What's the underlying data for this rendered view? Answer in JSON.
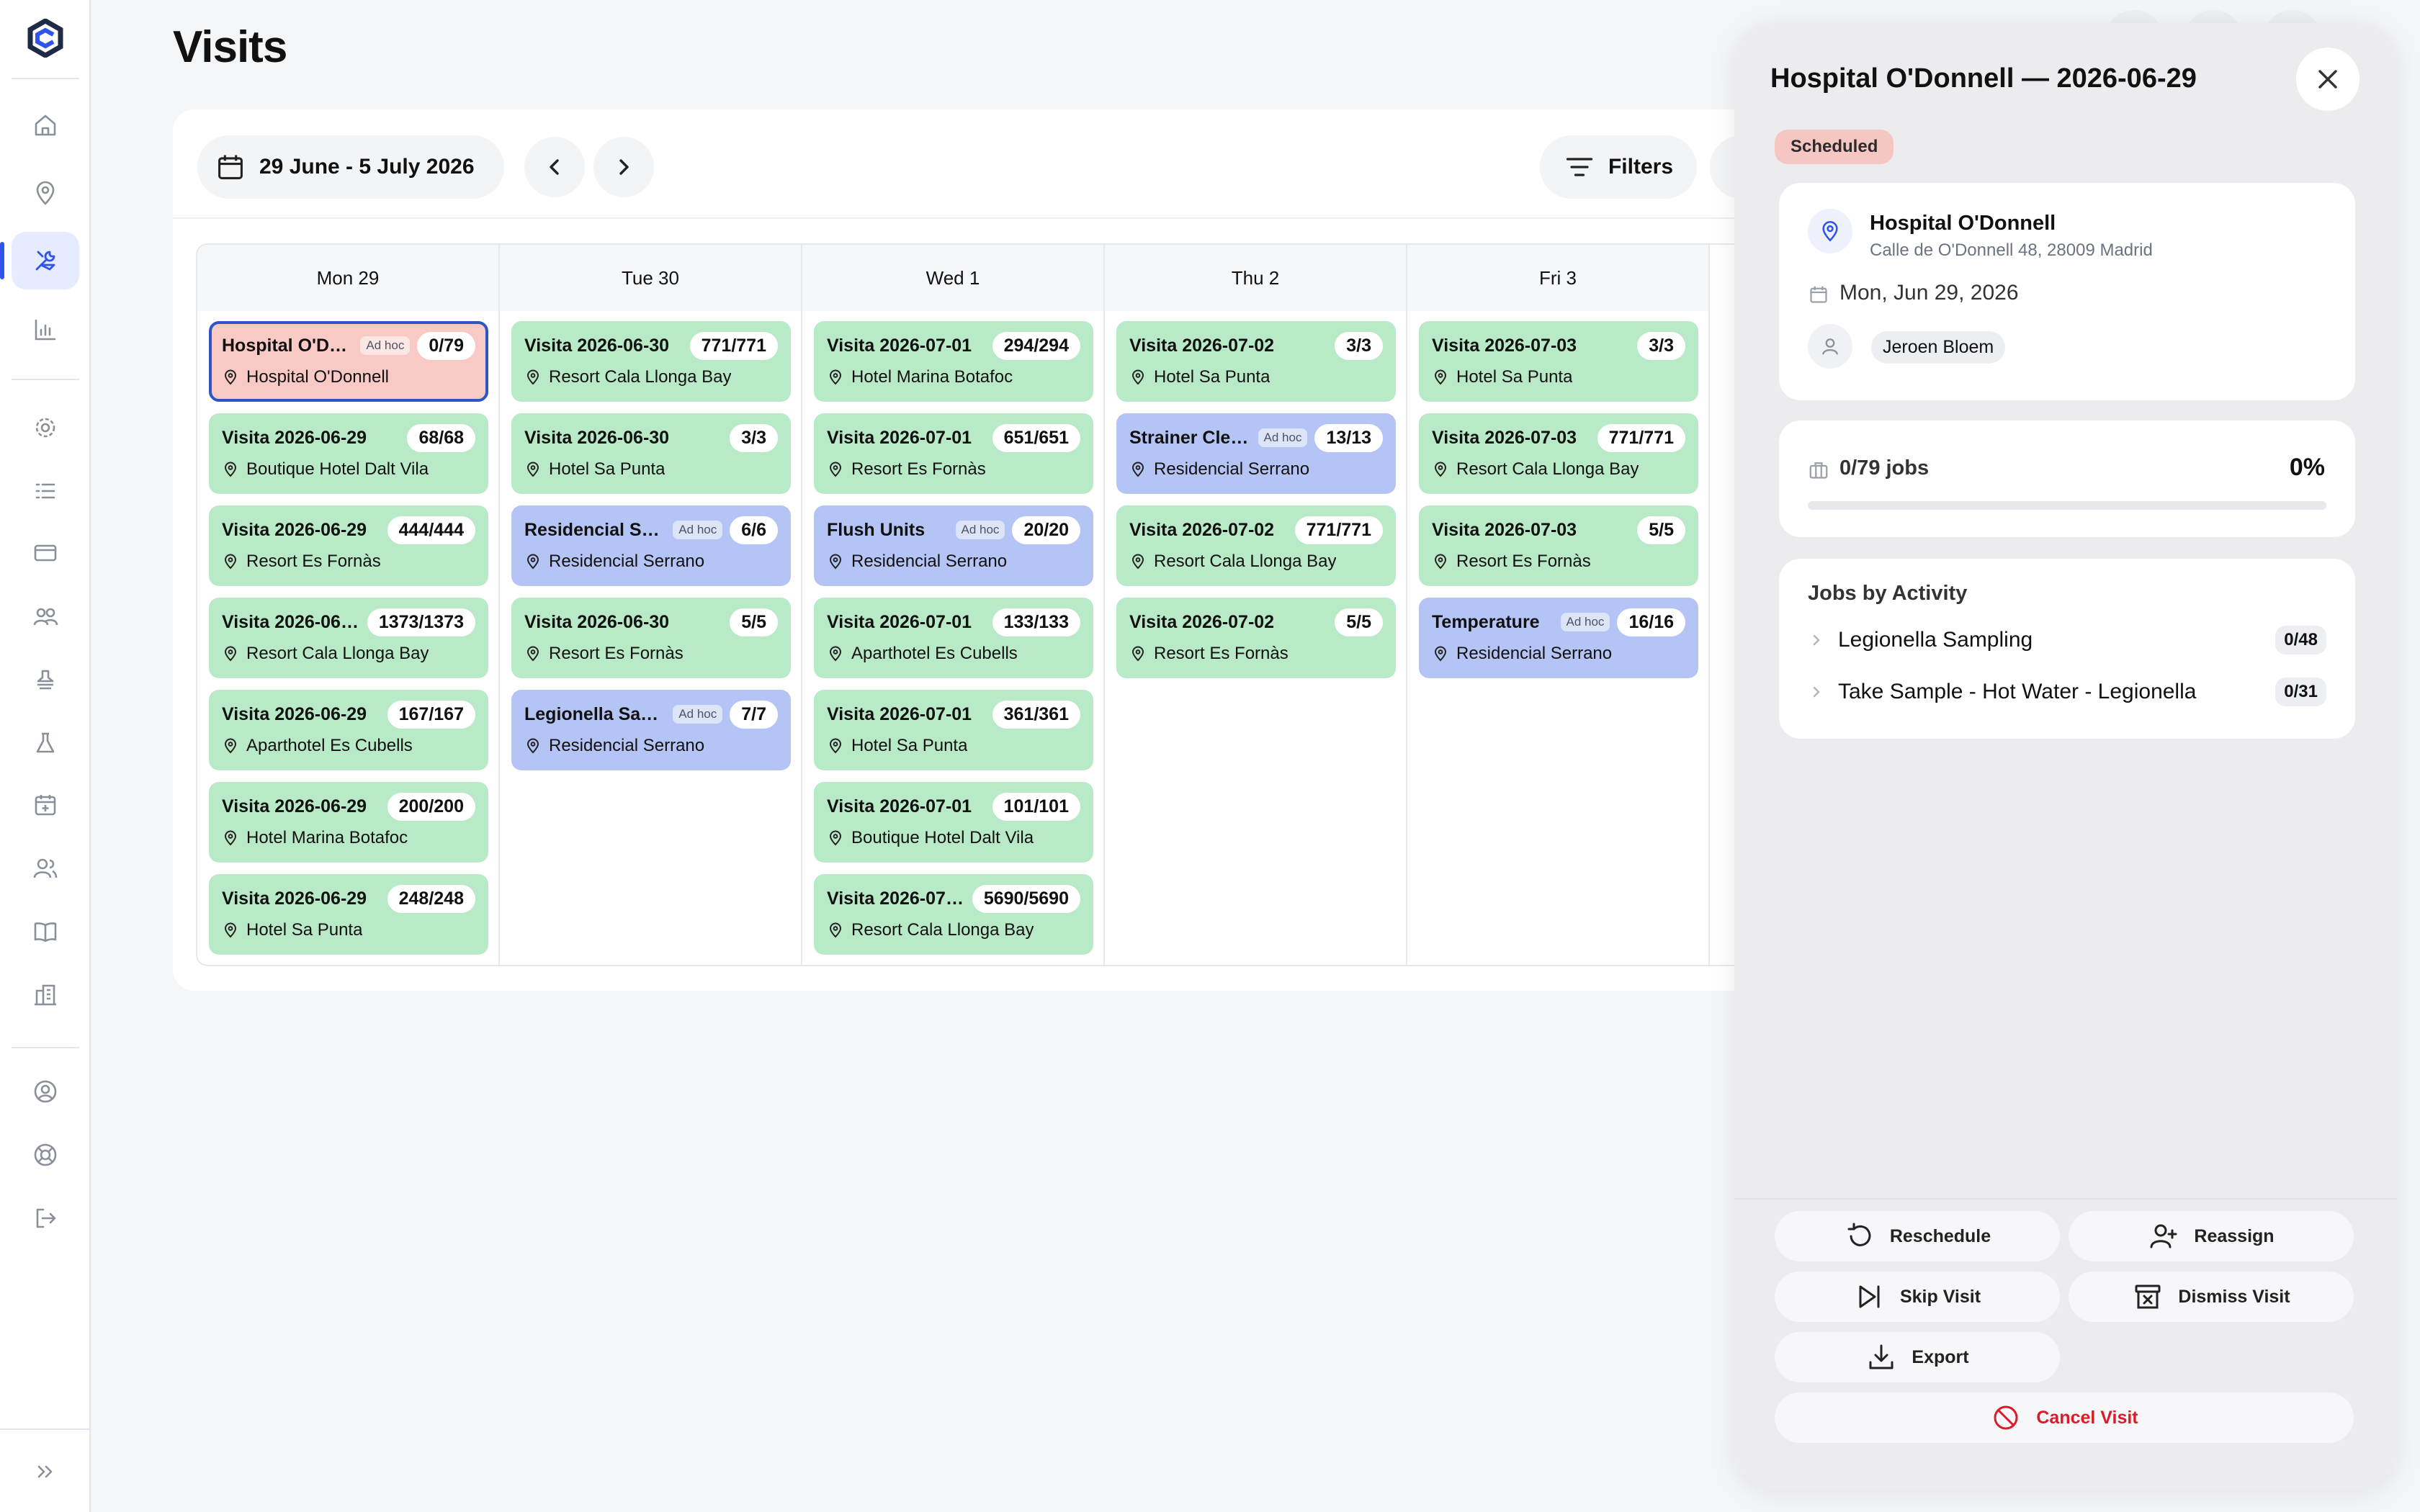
{
  "page": {
    "title": "Visits"
  },
  "toolbar": {
    "date_range": "29 June - 5 July 2026",
    "filters_label": "Filters"
  },
  "calendar": {
    "days": [
      "Mon 29",
      "Tue 30",
      "Wed 1",
      "Thu 2",
      "Fri 3"
    ],
    "columns": [
      [
        {
          "title": "Hospital O'Donnell",
          "adhoc": "Ad hoc",
          "count": "0/79",
          "location": "Hospital O'Donnell",
          "color": "red"
        },
        {
          "title": "Visita 2026-06-29",
          "count": "68/68",
          "location": "Boutique Hotel Dalt Vila",
          "color": "green"
        },
        {
          "title": "Visita 2026-06-29",
          "count": "444/444",
          "location": "Resort Es Fornàs",
          "color": "green"
        },
        {
          "title": "Visita 2026-06-29",
          "count": "1373/1373",
          "location": "Resort Cala Llonga Bay",
          "color": "green"
        },
        {
          "title": "Visita 2026-06-29",
          "count": "167/167",
          "location": "Aparthotel Es Cubells",
          "color": "green"
        },
        {
          "title": "Visita 2026-06-29",
          "count": "200/200",
          "location": "Hotel Marina Botafoc",
          "color": "green"
        },
        {
          "title": "Visita 2026-06-29",
          "count": "248/248",
          "location": "Hotel Sa Punta",
          "color": "green"
        }
      ],
      [
        {
          "title": "Visita 2026-06-30",
          "count": "771/771",
          "location": "Resort Cala Llonga Bay",
          "color": "green"
        },
        {
          "title": "Visita 2026-06-30",
          "count": "3/3",
          "location": "Hotel Sa Punta",
          "color": "green"
        },
        {
          "title": "Residencial Serrano",
          "adhoc": "Ad hoc",
          "count": "6/6",
          "location": "Residencial Serrano",
          "color": "blue"
        },
        {
          "title": "Visita 2026-06-30",
          "count": "5/5",
          "location": "Resort Es Fornàs",
          "color": "green"
        },
        {
          "title": "Legionella Sampling",
          "adhoc": "Ad hoc",
          "count": "7/7",
          "location": "Residencial Serrano",
          "color": "blue"
        }
      ],
      [
        {
          "title": "Visita 2026-07-01",
          "count": "294/294",
          "location": "Hotel Marina Botafoc",
          "color": "green"
        },
        {
          "title": "Visita 2026-07-01",
          "count": "651/651",
          "location": "Resort Es Fornàs",
          "color": "green"
        },
        {
          "title": "Flush Units",
          "adhoc": "Ad hoc",
          "count": "20/20",
          "location": "Residencial Serrano",
          "color": "blue"
        },
        {
          "title": "Visita 2026-07-01",
          "count": "133/133",
          "location": "Aparthotel Es Cubells",
          "color": "green"
        },
        {
          "title": "Visita 2026-07-01",
          "count": "361/361",
          "location": "Hotel Sa Punta",
          "color": "green"
        },
        {
          "title": "Visita 2026-07-01",
          "count": "101/101",
          "location": "Boutique Hotel Dalt Vila",
          "color": "green"
        },
        {
          "title": "Visita 2026-07-01",
          "count": "5690/5690",
          "location": "Resort Cala Llonga Bay",
          "color": "green"
        }
      ],
      [
        {
          "title": "Visita 2026-07-02",
          "count": "3/3",
          "location": "Hotel Sa Punta",
          "color": "green"
        },
        {
          "title": "Strainer Cleaning",
          "adhoc": "Ad hoc",
          "count": "13/13",
          "location": "Residencial Serrano",
          "color": "blue"
        },
        {
          "title": "Visita 2026-07-02",
          "count": "771/771",
          "location": "Resort Cala Llonga Bay",
          "color": "green"
        },
        {
          "title": "Visita 2026-07-02",
          "count": "5/5",
          "location": "Resort Es Fornàs",
          "color": "green"
        }
      ],
      [
        {
          "title": "Visita 2026-07-03",
          "count": "3/3",
          "location": "Hotel Sa Punta",
          "color": "green"
        },
        {
          "title": "Visita 2026-07-03",
          "count": "771/771",
          "location": "Resort Cala Llonga Bay",
          "color": "green"
        },
        {
          "title": "Visita 2026-07-03",
          "count": "5/5",
          "location": "Resort Es Fornàs",
          "color": "green"
        },
        {
          "title": "Temperature",
          "adhoc": "Ad hoc",
          "count": "16/16",
          "location": "Residencial Serrano",
          "color": "blue"
        }
      ]
    ]
  },
  "drawer": {
    "title": "Hospital O'Donnell — 2026-06-29",
    "status": "Scheduled",
    "location_name": "Hospital O'Donnell",
    "address": "Calle de O'Donnell 48, 28009 Madrid",
    "date": "Mon, Jun 29, 2026",
    "assignee": "Jeroen Bloem",
    "jobs_summary": "0/79 jobs",
    "jobs_percent": "0%",
    "progress_fraction": 0,
    "jobs_by_activity_title": "Jobs by Activity",
    "activities": [
      {
        "name": "Legionella Sampling",
        "count": "0/48"
      },
      {
        "name": "Take Sample - Hot Water - Legionella",
        "count": "0/31"
      }
    ],
    "buttons": {
      "reschedule": "Reschedule",
      "reassign": "Reassign",
      "skip": "Skip Visit",
      "dismiss": "Dismiss Visit",
      "export": "Export",
      "cancel": "Cancel Visit"
    }
  },
  "colors": {
    "accent": "#2f54eb",
    "visit_green": "#b9eac8",
    "visit_blue": "#b4c4f4",
    "visit_selected": "#f9c9c6",
    "status_scheduled": "#f6c6c3",
    "danger": "#d91c2a"
  },
  "icons": {
    "sidebar": [
      "home-icon",
      "map-pin-icon",
      "tools-icon",
      "bar-chart-icon",
      "settings-icon",
      "checklist-icon",
      "card-icon",
      "groups-icon",
      "stamp-icon",
      "flask-icon",
      "calendar-plus-icon",
      "users-icon",
      "book-icon",
      "building-icon",
      "user-circle-icon",
      "lifebuoy-icon",
      "logout-icon",
      "expand-icon"
    ]
  }
}
